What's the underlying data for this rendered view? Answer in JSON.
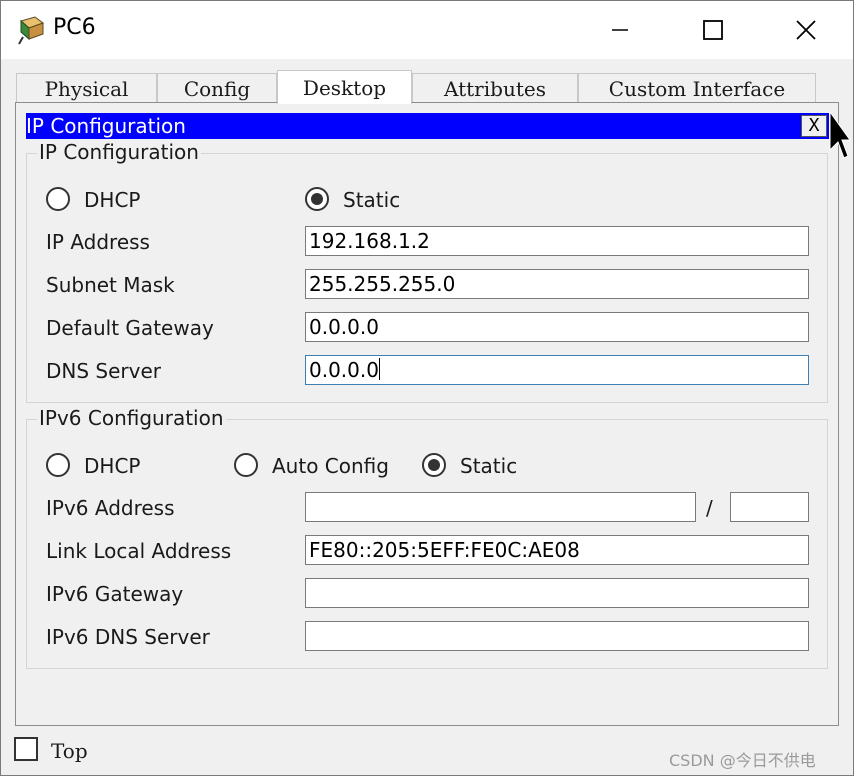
{
  "window": {
    "title": "PC6",
    "watermark": "CSDN @今日不供电"
  },
  "tabs": [
    {
      "label": "Physical"
    },
    {
      "label": "Config"
    },
    {
      "label": "Desktop"
    },
    {
      "label": "Attributes"
    },
    {
      "label": "Custom Interface"
    }
  ],
  "active_tab": "Desktop",
  "ip_panel": {
    "title": "IP Configuration",
    "close_label": "X",
    "ipv4": {
      "title": "IP Configuration",
      "dhcp_label": "DHCP",
      "static_label": "Static",
      "selected_mode": "Static",
      "fields": [
        {
          "label": "IP Address",
          "value": "192.168.1.2"
        },
        {
          "label": "Subnet Mask",
          "value": "255.255.255.0"
        },
        {
          "label": "Default Gateway",
          "value": "0.0.0.0"
        },
        {
          "label": "DNS Server",
          "value": "0.0.0.0"
        }
      ]
    },
    "ipv6": {
      "title": "IPv6 Configuration",
      "dhcp_label": "DHCP",
      "auto_label": "Auto Config",
      "static_label": "Static",
      "selected_mode": "Static",
      "address_label": "IPv6 Address",
      "address_value": "",
      "prefix_separator": "/",
      "prefix_value": "",
      "link_local_label": "Link Local Address",
      "link_local_value": "FE80::205:5EFF:FE0C:AE08",
      "gateway_label": "IPv6 Gateway",
      "gateway_value": "",
      "dns_label": "IPv6 DNS Server",
      "dns_value": ""
    }
  },
  "footer": {
    "top_label": "Top",
    "top_checked": false
  },
  "colors": {
    "panel_title_bar": "#0000ff",
    "window_bg": "#f0f0f0"
  },
  "icons": {
    "app": "pc-app-icon",
    "minimize": "minimize-icon",
    "maximize": "maximize-icon",
    "close": "close-icon"
  }
}
